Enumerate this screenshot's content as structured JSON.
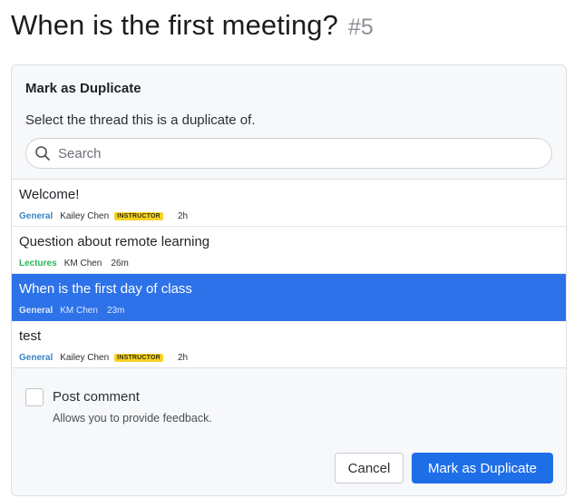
{
  "header": {
    "title": "When is the first meeting?",
    "number": "#5"
  },
  "dialog": {
    "heading": "Mark as Duplicate",
    "description": "Select the thread this is a duplicate of.",
    "search": {
      "placeholder": "Search",
      "value": "",
      "icon": "search-icon"
    },
    "threads": [
      {
        "title": "Welcome!",
        "category": "General",
        "author": "Kailey Chen",
        "badge": "INSTRUCTOR",
        "time": "2h",
        "selected": false
      },
      {
        "title": "Question about remote learning",
        "category": "Lectures",
        "author": "KM Chen",
        "badge": "",
        "time": "26m",
        "selected": false
      },
      {
        "title": "When is the first day of class",
        "category": "General",
        "author": "KM Chen",
        "badge": "",
        "time": "23m",
        "selected": true
      },
      {
        "title": "test",
        "category": "General",
        "author": "Kailey Chen",
        "badge": "INSTRUCTOR",
        "time": "2h",
        "selected": false
      }
    ],
    "post_comment": {
      "label": "Post comment",
      "help": "Allows you to provide feedback.",
      "checked": false
    },
    "buttons": {
      "cancel": "Cancel",
      "confirm": "Mark as Duplicate"
    }
  },
  "colors": {
    "accent": "#1e6ee8",
    "selected_row": "#2d72e8",
    "category_general": "#3a85c7",
    "category_lectures": "#2fb35a",
    "instructor_badge": "#f5d328"
  }
}
